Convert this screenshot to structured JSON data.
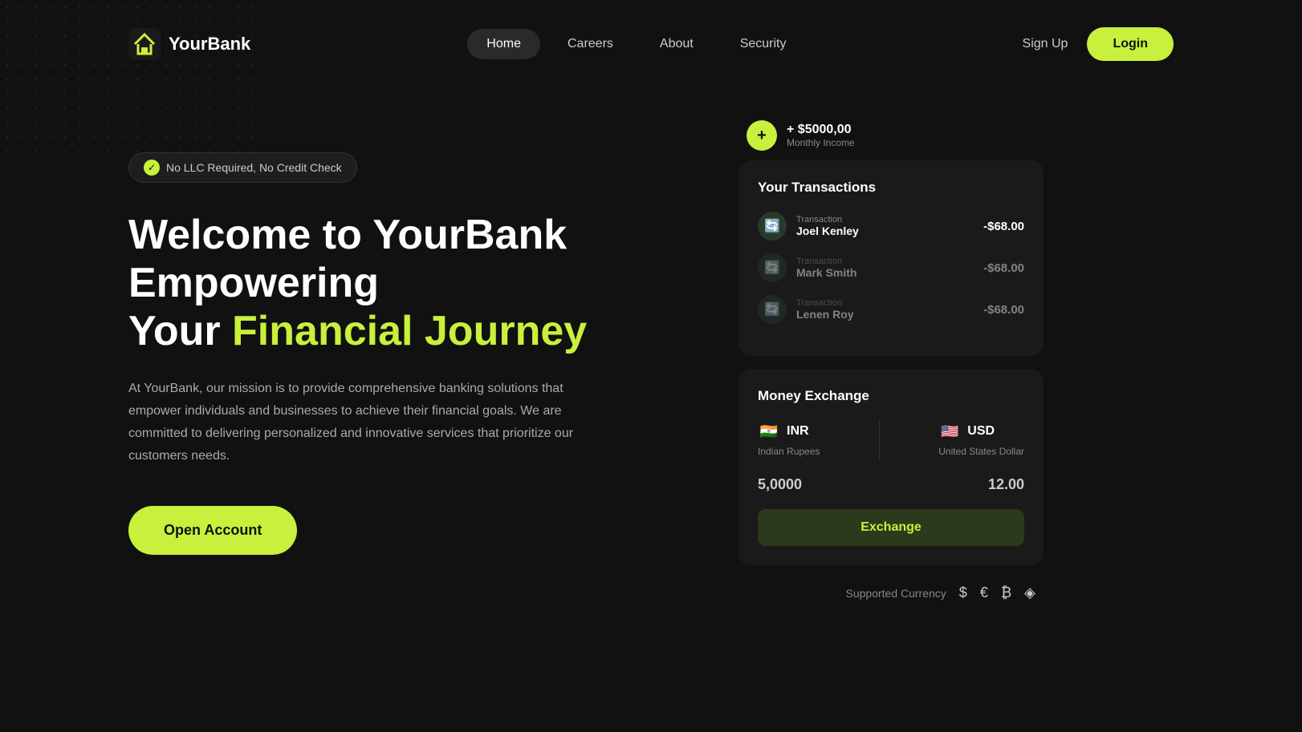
{
  "meta": {
    "title": "YourBank"
  },
  "navbar": {
    "logo_text": "YourBank",
    "links": [
      {
        "label": "Home",
        "active": true
      },
      {
        "label": "Careers",
        "active": false
      },
      {
        "label": "About",
        "active": false
      },
      {
        "label": "Security",
        "active": false
      }
    ],
    "signup_label": "Sign Up",
    "login_label": "Login"
  },
  "hero": {
    "badge_text": "No LLC Required, No Credit Check",
    "title_line1": "Welcome to YourBank Empowering",
    "title_line2": "Your ",
    "title_highlight": "Financial Journey",
    "description": "At YourBank, our mission is to provide comprehensive banking solutions that empower individuals and businesses to achieve their financial goals. We are committed to delivering personalized and innovative services that prioritize our customers needs.",
    "cta_label": "Open Account"
  },
  "income": {
    "amount": "+ $5000,00",
    "label": "Monthly Income",
    "icon": "+"
  },
  "transactions": {
    "title": "Your Transactions",
    "items": [
      {
        "type": "Transaction",
        "name": "Joel Kenley",
        "amount": "-$68.00",
        "faded": false
      },
      {
        "type": "Transaction",
        "name": "Mark Smith",
        "amount": "-$68.00",
        "faded": true
      },
      {
        "type": "Transaction",
        "name": "Lenen Roy",
        "amount": "-$68.00",
        "faded": true
      }
    ]
  },
  "exchange": {
    "title": "Money Exchange",
    "from": {
      "code": "INR",
      "name": "Indian Rupees",
      "flag": "🇮🇳",
      "value": "5,0000"
    },
    "to": {
      "code": "USD",
      "name": "United States Dollar",
      "flag": "🇺🇸",
      "value": "12.00"
    },
    "button_label": "Exchange"
  },
  "supported_currency": {
    "label": "Supported Currency",
    "symbols": [
      "$",
      "€",
      "₿",
      "◈"
    ]
  }
}
